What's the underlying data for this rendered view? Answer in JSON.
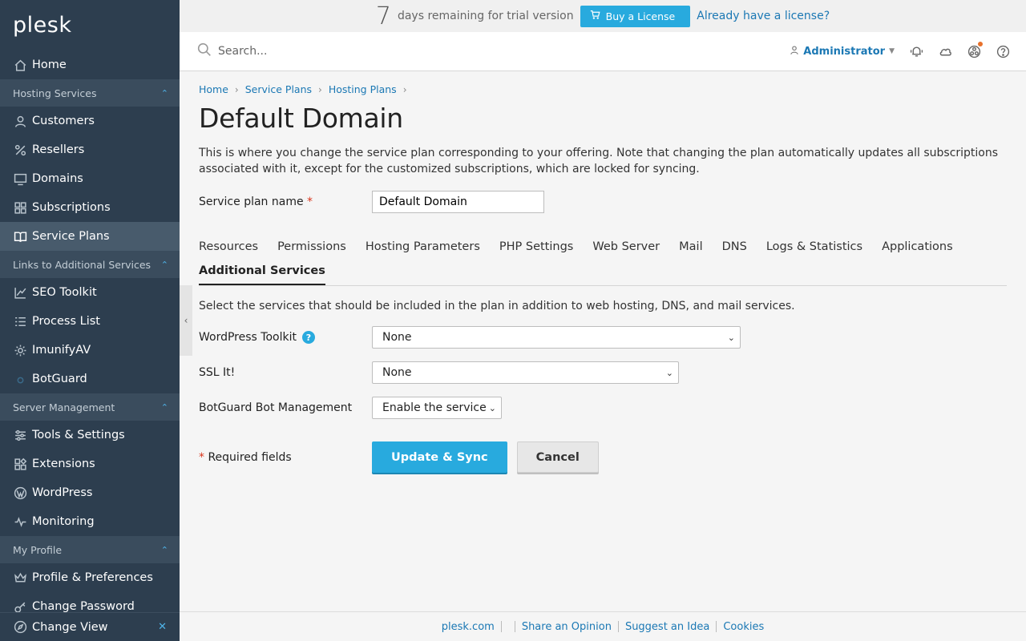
{
  "brand": {
    "logo": "plesk"
  },
  "sidebar": {
    "home": "Home",
    "sections": [
      {
        "title": "Hosting Services",
        "items": [
          "Customers",
          "Resellers",
          "Domains",
          "Subscriptions",
          "Service Plans"
        ]
      },
      {
        "title": "Links to Additional Services",
        "items": [
          "SEO Toolkit",
          "Process List",
          "ImunifyAV",
          "BotGuard"
        ]
      },
      {
        "title": "Server Management",
        "items": [
          "Tools & Settings",
          "Extensions",
          "WordPress",
          "Monitoring"
        ]
      },
      {
        "title": "My Profile",
        "items": [
          "Profile & Preferences",
          "Change Password"
        ]
      }
    ],
    "bottom": "Change View",
    "active": "Service Plans"
  },
  "trial": {
    "days": "7",
    "text": "days remaining for trial version",
    "buy_label": "Buy a License",
    "license_link": "Already have a license?"
  },
  "header": {
    "search_placeholder": "Search...",
    "user": "Administrator"
  },
  "breadcrumb": [
    "Home",
    "Service Plans",
    "Hosting Plans"
  ],
  "page": {
    "title": "Default Domain",
    "description": "This is where you change the service plan corresponding to your offering. Note that changing the plan automatically updates all subscriptions associated with it, except for the customized subscriptions, which are locked for syncing.",
    "plan_name_label": "Service plan name",
    "plan_name_value": "Default Domain",
    "required_mark": "*"
  },
  "tabs": {
    "items": [
      "Resources",
      "Permissions",
      "Hosting Parameters",
      "PHP Settings",
      "Web Server",
      "Mail",
      "DNS",
      "Logs & Statistics",
      "Applications",
      "Additional Services"
    ],
    "active": "Additional Services"
  },
  "services": {
    "instructions": "Select the services that should be included in the plan in addition to web hosting, DNS, and mail services.",
    "wp_label": "WordPress Toolkit",
    "wp_value": "None",
    "ssl_label": "SSL It!",
    "ssl_value": "None",
    "botguard_label": "BotGuard Bot Management",
    "botguard_value": "Enable the service"
  },
  "actions": {
    "required_text": "Required fields",
    "update": "Update & Sync",
    "cancel": "Cancel"
  },
  "footer": {
    "links": [
      "plesk.com",
      "Share an Opinion",
      "Suggest an Idea",
      "Cookies"
    ]
  },
  "colors": {
    "sidebar_bg": "#2d3e4f",
    "accent": "#28aade",
    "link": "#1b78b4",
    "required": "#d9351d"
  }
}
